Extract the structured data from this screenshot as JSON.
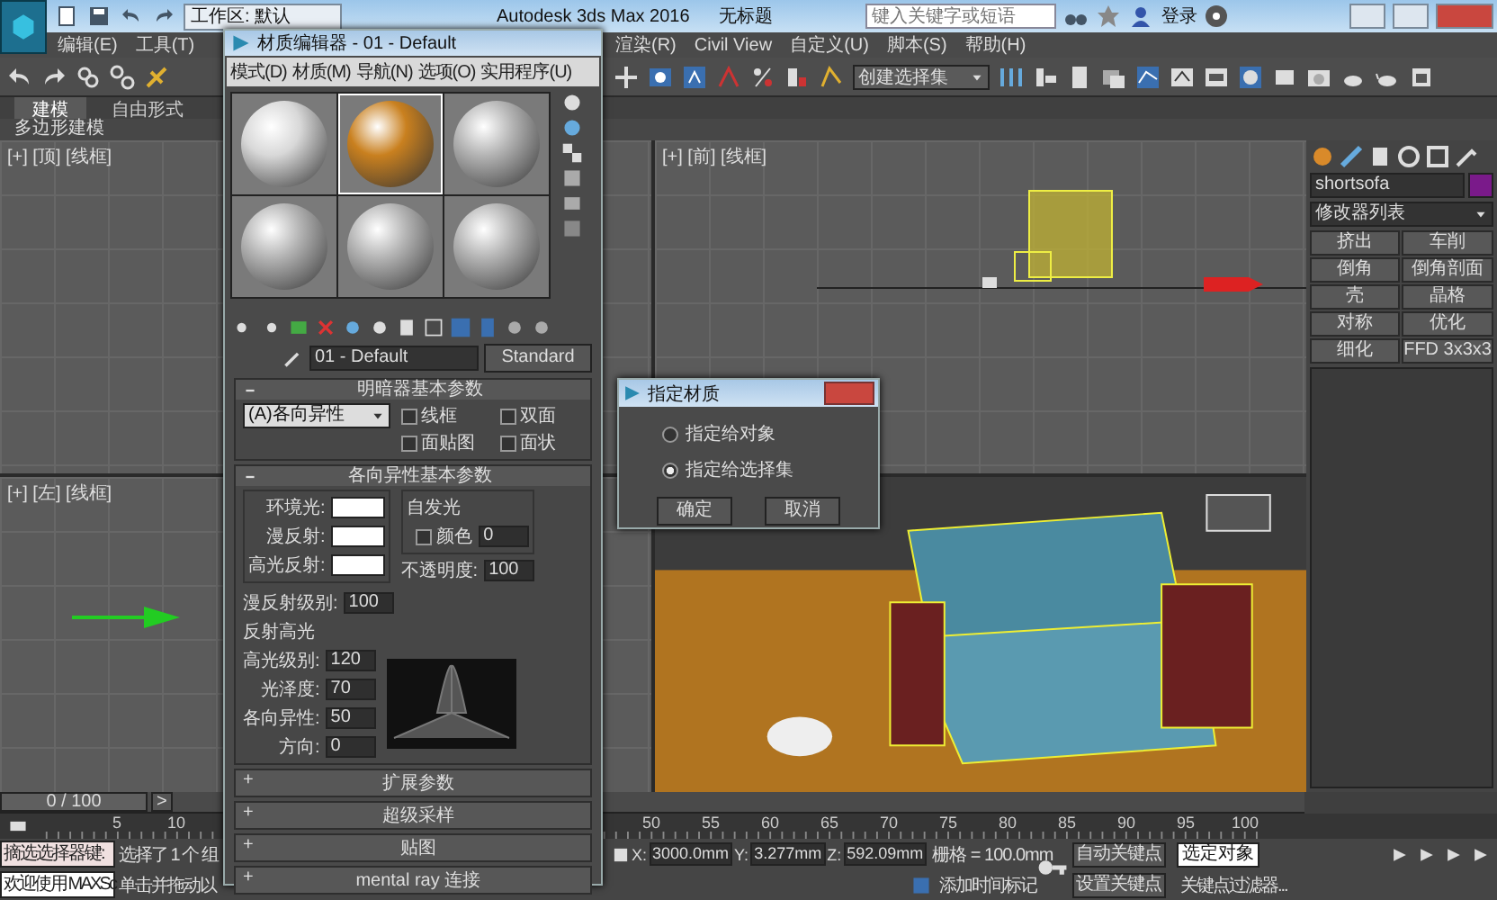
{
  "title_bar": {
    "workspace": "工作区: 默认",
    "title": "Autodesk 3ds Max 2016",
    "document": "无标题",
    "search_placeholder": "键入关键字或短语",
    "sign_in": "登录"
  },
  "menu_bar": {
    "left": [
      "编辑(E)",
      "工具(T)"
    ],
    "right": [
      "渲染(R)",
      "Civil View",
      "自定义(U)",
      "脚本(S)",
      "帮助(H)"
    ]
  },
  "toolbar": {
    "selection_set": "创建选择集"
  },
  "ribbon": {
    "tabs": [
      {
        "label": "建模",
        "selected": true
      },
      {
        "label": "自由形式",
        "selected": false
      }
    ],
    "panel_title": "多边形建模"
  },
  "viewports": {
    "top_left": "[+] [顶] [线框]",
    "top_right": "[+] [前] [线框]",
    "bottom_left": "[+] [左] [线框]"
  },
  "command_panel": {
    "object_name": "shortsofa",
    "modifier_list": "修改器列表",
    "modifiers": [
      "挤出",
      "车削",
      "倒角",
      "倒角剖面",
      "壳",
      "晶格",
      "对称",
      "优化",
      "细化",
      "FFD 3x3x3"
    ]
  },
  "material_editor": {
    "title": "材质编辑器 - 01 - Default",
    "menus": [
      "模式(D)",
      "材质(M)",
      "导航(N)",
      "选项(O)",
      "实用程序(U)"
    ],
    "slots": [
      {
        "color": "#d8d8d8",
        "selected": false
      },
      {
        "color": "#c9801f",
        "selected": true
      },
      {
        "color": "#b4b4b4",
        "selected": false
      },
      {
        "color": "#b4b4b4",
        "selected": false
      },
      {
        "color": "#b4b4b4",
        "selected": false
      },
      {
        "color": "#b4b4b4",
        "selected": false
      }
    ],
    "material_name": "01 - Default",
    "material_type": "Standard",
    "shader_rollout": {
      "title": "明暗器基本参数",
      "shader": "(A)各向异性",
      "options": [
        {
          "label": "线框",
          "checked": false
        },
        {
          "label": "双面",
          "checked": false
        },
        {
          "label": "面贴图",
          "checked": false
        },
        {
          "label": "面状",
          "checked": false
        }
      ]
    },
    "basic_rollout": {
      "title": "各向异性基本参数",
      "colors": [
        {
          "label": "环境光:"
        },
        {
          "label": "漫反射:"
        },
        {
          "label": "高光反射:"
        }
      ],
      "self_illum_title": "自发光",
      "self_illum_label": "颜色",
      "self_illum_value": "0",
      "self_illum_checked": false,
      "opacity_label": "不透明度:",
      "opacity_value": "100",
      "diffuse_level_label": "漫反射级别:",
      "diffuse_level_value": "100",
      "highlight_title": "反射高光",
      "highlight_fields": [
        {
          "label": "高光级别:",
          "value": "120"
        },
        {
          "label": "光泽度:",
          "value": "70"
        },
        {
          "label": "各向异性:",
          "value": "50"
        },
        {
          "label": "方向:",
          "value": "0"
        }
      ]
    },
    "closed_rollouts": [
      {
        "sign": "+",
        "title": "扩展参数"
      },
      {
        "sign": "+",
        "title": "超级采样"
      },
      {
        "sign": "+",
        "title": "贴图"
      },
      {
        "sign": "+",
        "title": "mental ray 连接"
      }
    ]
  },
  "dialog": {
    "title": "指定材质",
    "options": [
      {
        "label": "指定给对象",
        "selected": false
      },
      {
        "label": "指定给选择集",
        "selected": true
      }
    ],
    "buttons": [
      "确定",
      "取消"
    ]
  },
  "timeline": {
    "frame": "0 / 100",
    "level": 0,
    "next": ">",
    "ticks": [
      "5",
      "10",
      "50",
      "55",
      "60",
      "65",
      "70",
      "75",
      "80",
      "85",
      "90",
      "95",
      "100"
    ]
  },
  "status": {
    "listener": [
      "摘选选择器",
      "欢迎使用 MAXSc"
    ],
    "listener_key": "键:",
    "selection": "选择了 1 个 组",
    "prompt": "单击并拖动以",
    "x_label": "X:",
    "x": "3000.0mm",
    "y_label": "Y:",
    "y": "3.277mm",
    "z_label": "Z:",
    "z": "592.09mm",
    "grid": "栅格 = 100.0mm",
    "time_tag": "添加时间标记",
    "auto_key": "自动关键点",
    "key_mode": "选定对象",
    "set_key": "设置关键点",
    "key_filters": "关键点过滤器..."
  }
}
